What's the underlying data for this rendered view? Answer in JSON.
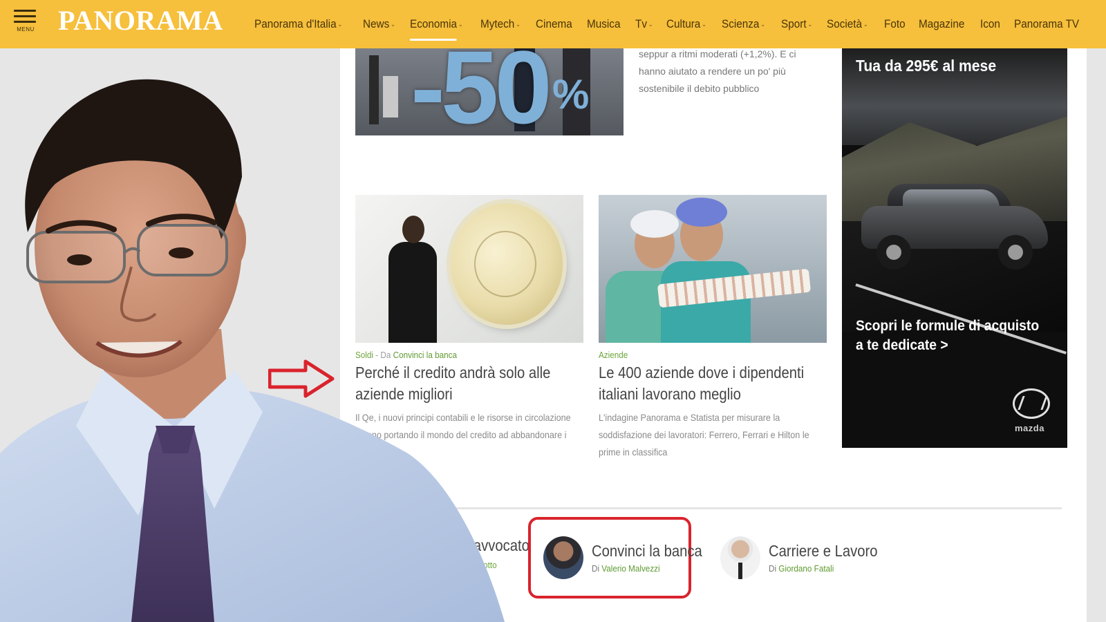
{
  "header": {
    "menu_label": "MENU",
    "logo": "PANORAMA",
    "nav": [
      {
        "label": "Panorama d'Italia",
        "has_dropdown": true
      },
      {
        "label": "News",
        "has_dropdown": true
      },
      {
        "label": "Economia",
        "has_dropdown": true,
        "active": true
      },
      {
        "label": "Mytech",
        "has_dropdown": true
      },
      {
        "label": "Cinema",
        "has_dropdown": false
      },
      {
        "label": "Musica",
        "has_dropdown": false
      },
      {
        "label": "Tv",
        "has_dropdown": true
      },
      {
        "label": "Cultura",
        "has_dropdown": true
      },
      {
        "label": "Scienza",
        "has_dropdown": true
      },
      {
        "label": "Sport",
        "has_dropdown": true
      },
      {
        "label": "Società",
        "has_dropdown": true
      },
      {
        "label": "Foto",
        "has_dropdown": false
      },
      {
        "label": "Magazine",
        "has_dropdown": false
      },
      {
        "label": "Icon",
        "has_dropdown": false
      },
      {
        "label": "Panorama TV",
        "has_dropdown": false
      }
    ]
  },
  "top_article": {
    "image_text": "-50",
    "image_pct": "%",
    "snippet": "seppur a ritmi moderati (+1,2%). E ci hanno aiutato a rendere un po' più sostenibile il debito pubblico"
  },
  "articles": [
    {
      "category": "Soldi",
      "separator": " - Da ",
      "blog": "Convinci la banca",
      "title": "Perché il credito andrà solo alle aziende migliori",
      "description": "Il Qe, i nuovi principi contabili e le risorse in circolazione stanno portando il mondo del credito ad abbandonare i peggiori"
    },
    {
      "category": "Aziende",
      "title": "Le 400 aziende dove i dipendenti italiani lavorano meglio",
      "description": "L'indagine Panorama e Statista per misurare la soddisfazione dei lavoratori: Ferrero, Ferrari e Hilton le prime in classifica"
    }
  ],
  "ad": {
    "headline": "Tua da 295€ al mese",
    "cta": "Scopri le formule di acquisto a te dedicate >",
    "brand": "mazda"
  },
  "blogs": {
    "clipped_title": "ll'avvocato",
    "clipped_author": "inotto",
    "items": [
      {
        "title": "Convinci la banca",
        "author_prefix": "Di ",
        "author": "Valerio Malvezzi",
        "highlighted": true
      },
      {
        "title": "Carriere e Lavoro",
        "author_prefix": "Di ",
        "author": "Giordano Fatali",
        "highlighted": false
      }
    ]
  },
  "colors": {
    "header_bg": "#f6bf3c",
    "accent_green": "#6aa43a",
    "highlight_red": "#d9232d",
    "arrow_red": "#d9232d"
  }
}
